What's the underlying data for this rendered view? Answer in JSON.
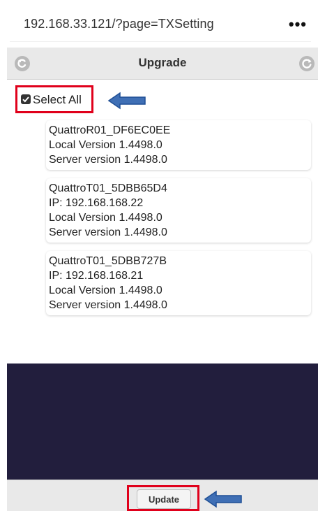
{
  "browser": {
    "url": "192.168.33.121/?page=TXSetting",
    "more_icon": "ellipsis-icon"
  },
  "header": {
    "title": "Upgrade",
    "left_icon": "back-icon",
    "right_icon": "refresh-icon"
  },
  "select_all": {
    "label": "Select All",
    "checked": true
  },
  "devices": [
    {
      "name": "QuattroR01_DF6EC0EE",
      "local_version": "Local Version 1.4498.0",
      "server_version": "Server version 1.4498.0"
    },
    {
      "name": "QuattroT01_5DBB65D4",
      "ip": "IP: 192.168.168.22",
      "local_version": "Local Version 1.4498.0",
      "server_version": "Server version 1.4498.0"
    },
    {
      "name": "QuattroT01_5DBB727B",
      "ip": "IP: 192.168.168.21",
      "local_version": "Local Version 1.4498.0",
      "server_version": "Server version 1.4498.0"
    }
  ],
  "footer": {
    "update_label": "Update"
  },
  "colors": {
    "highlight": "#e0001b",
    "arrow": "#3f6fb5",
    "dark_panel": "#221e3d",
    "header_bg": "#e9e9e9"
  }
}
